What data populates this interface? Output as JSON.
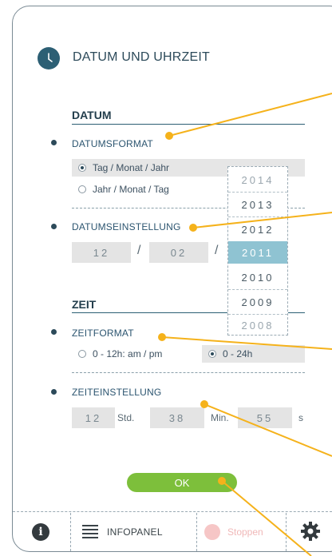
{
  "page": {
    "title": "DATUM UND UHRZEIT"
  },
  "datum": {
    "section_title": "DATUM",
    "format_label": "DATUMSFORMAT",
    "options": [
      {
        "label": "Tag / Monat / Jahr",
        "selected": true
      },
      {
        "label": "Jahr / Monat / Tag",
        "selected": false
      }
    ],
    "setting_label": "DATUMSEINSTELLUNG",
    "day": "12",
    "month": "02",
    "separator": "/"
  },
  "year_picker": {
    "years": [
      "2014",
      "2013",
      "2012",
      "2011",
      "2010",
      "2009",
      "2008"
    ],
    "selected": "2011"
  },
  "zeit": {
    "section_title": "ZEIT",
    "format_label": "ZEITFORMAT",
    "options": [
      {
        "label": "0 - 12h: am / pm",
        "selected": false
      },
      {
        "label": "0 - 24h",
        "selected": true
      }
    ],
    "setting_label": "ZEITEINSTELLUNG",
    "hours": "12",
    "hours_unit": "Std.",
    "minutes": "38",
    "minutes_unit": "Min.",
    "seconds": "55",
    "seconds_unit": "s"
  },
  "ok_button": {
    "label": "OK"
  },
  "footer": {
    "info_icon": "info-icon",
    "info_glyph": "i",
    "menu_icon": "menu-icon",
    "infopanel_label": "INFOPANEL",
    "stop_label": "Stoppen",
    "settings_icon": "gear-icon"
  },
  "colors": {
    "accent": "#2c5f74",
    "ok_green": "#7dbf3b",
    "picker_selected": "#8fc3d2",
    "callout_orange": "#f5b21b",
    "stop_pink": "#f6c6c6"
  }
}
